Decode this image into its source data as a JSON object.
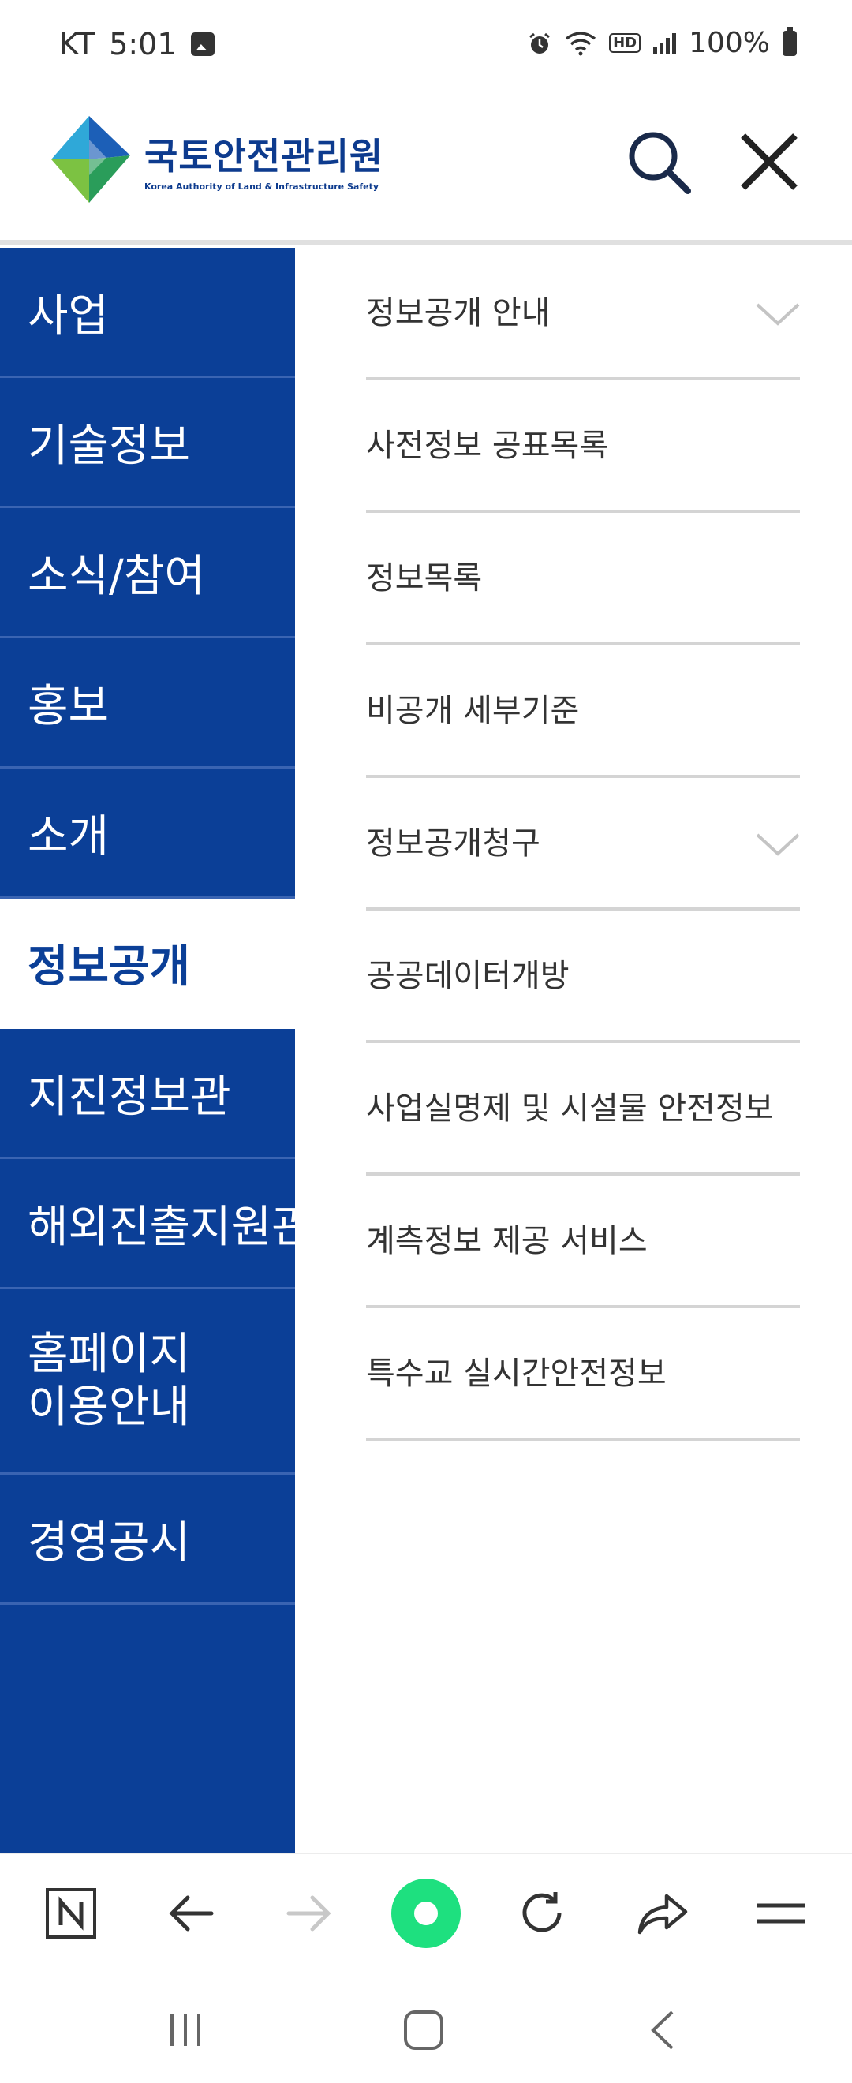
{
  "status_bar": {
    "carrier": "KT",
    "time": "5:01",
    "battery": "100%",
    "icons": [
      "image-icon",
      "alarm-icon",
      "wifi-icon",
      "hd-icon",
      "signal-icon",
      "battery-icon"
    ]
  },
  "header": {
    "logo_korean": "국토안전관리원",
    "logo_english": "Korea Authority of Land & Infrastructure Safety",
    "icons": [
      "search-icon",
      "close-icon"
    ]
  },
  "nav": {
    "items": [
      {
        "label": "사업",
        "active": false
      },
      {
        "label": "기술정보",
        "active": false
      },
      {
        "label": "소식/참여",
        "active": false
      },
      {
        "label": "홍보",
        "active": false
      },
      {
        "label": "소개",
        "active": false
      },
      {
        "label": "정보공개",
        "active": true
      },
      {
        "label": "지진정보관",
        "active": false
      },
      {
        "label": "해외진출지원관",
        "active": false
      },
      {
        "label": "홈페이지 이용안내",
        "active": false
      },
      {
        "label": "경영공시",
        "active": false
      }
    ]
  },
  "submenu": {
    "items": [
      {
        "label": "정보공개 안내",
        "expandable": true
      },
      {
        "label": "사전정보 공표목록",
        "expandable": false
      },
      {
        "label": "정보목록",
        "expandable": false
      },
      {
        "label": "비공개 세부기준",
        "expandable": false
      },
      {
        "label": "정보공개청구",
        "expandable": true
      },
      {
        "label": "공공데이터개방",
        "expandable": false
      },
      {
        "label": "사업실명제 및 시설물 안전정보",
        "expandable": false
      },
      {
        "label": "계측정보 제공 서비스",
        "expandable": false
      },
      {
        "label": "특수교 실시간안전정보",
        "expandable": false
      }
    ]
  },
  "toolbar": {
    "icons": [
      "naver-n-icon",
      "back-arrow-icon",
      "forward-arrow-icon",
      "green-dot-icon",
      "reload-icon",
      "share-icon",
      "menu-icon"
    ]
  },
  "system_nav": {
    "icons": [
      "recents-icon",
      "home-icon",
      "back-icon"
    ]
  },
  "colors": {
    "nav_bg": "#0b3f97",
    "active_text": "#0b3f97",
    "green_button": "#1ee07f"
  }
}
